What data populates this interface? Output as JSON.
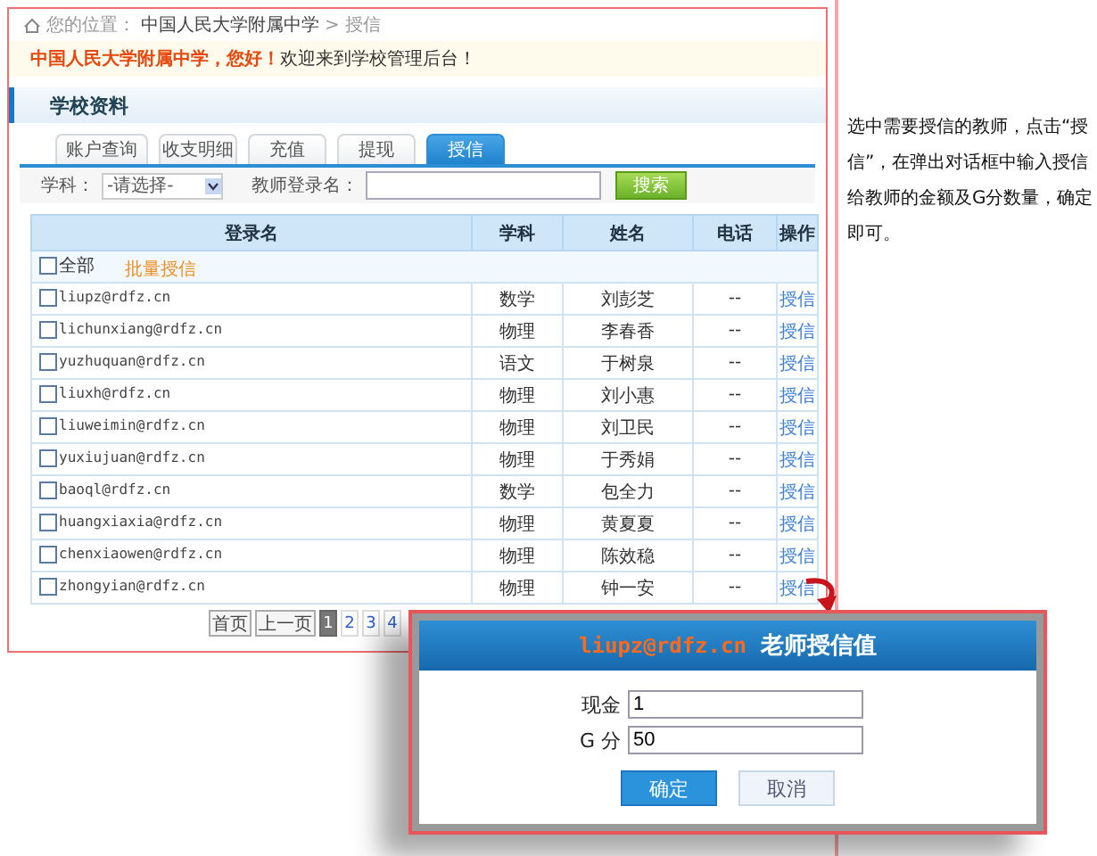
{
  "breadcrumb": {
    "label": "您的位置：",
    "school": "中国人民大学附属中学",
    "separator": ">",
    "current": "授信"
  },
  "welcome": {
    "school": "中国人民大学附属中学，您好！",
    "message": "欢迎来到学校管理后台！"
  },
  "section_title": "学校资料",
  "tabs": [
    {
      "label": "账户查询",
      "selected": false
    },
    {
      "label": "收支明细",
      "selected": false
    },
    {
      "label": "充值",
      "selected": false
    },
    {
      "label": "提现",
      "selected": false
    },
    {
      "label": "授信",
      "selected": true
    }
  ],
  "filter": {
    "subject_label": "学科：",
    "subject_value": "-请选择-",
    "teacher_label": "教师登录名：",
    "search_button": "搜索"
  },
  "table": {
    "columns": [
      "登录名",
      "学科",
      "姓名",
      "电话",
      "操作"
    ],
    "select_all": {
      "label": "全部",
      "checked": false
    },
    "batch_link": "批量授信",
    "rows": [
      {
        "login": "liupz@rdfz.cn",
        "subject": "数学",
        "name": "刘彭芝",
        "phone": "--",
        "action": "授信",
        "checked": false
      },
      {
        "login": "lichunxiang@rdfz.cn",
        "subject": "物理",
        "name": "李春香",
        "phone": "--",
        "action": "授信",
        "checked": false
      },
      {
        "login": "yuzhuquan@rdfz.cn",
        "subject": "语文",
        "name": "于树泉",
        "phone": "--",
        "action": "授信",
        "checked": false
      },
      {
        "login": "liuxh@rdfz.cn",
        "subject": "物理",
        "name": "刘小惠",
        "phone": "--",
        "action": "授信",
        "checked": false
      },
      {
        "login": "liuweimin@rdfz.cn",
        "subject": "物理",
        "name": "刘卫民",
        "phone": "--",
        "action": "授信",
        "checked": false
      },
      {
        "login": "yuxiujuan@rdfz.cn",
        "subject": "物理",
        "name": "于秀娟",
        "phone": "--",
        "action": "授信",
        "checked": false
      },
      {
        "login": "baoql@rdfz.cn",
        "subject": "数学",
        "name": "包全力",
        "phone": "--",
        "action": "授信",
        "checked": false
      },
      {
        "login": "huangxiaxia@rdfz.cn",
        "subject": "物理",
        "name": "黄夏夏",
        "phone": "--",
        "action": "授信",
        "checked": false
      },
      {
        "login": "chenxiaowen@rdfz.cn",
        "subject": "物理",
        "name": "陈效稳",
        "phone": "--",
        "action": "授信",
        "checked": false
      },
      {
        "login": "zhongyian@rdfz.cn",
        "subject": "物理",
        "name": "钟一安",
        "phone": "--",
        "action": "授信",
        "checked": false
      }
    ]
  },
  "pagination": {
    "first": "首页",
    "prev": "上一页",
    "pages": [
      {
        "label": "1",
        "selected": true
      },
      {
        "label": "2",
        "selected": false
      },
      {
        "label": "3",
        "selected": false
      },
      {
        "label": "4",
        "selected": false
      }
    ]
  },
  "note": "选中需要授信的教师，点击“授信”，在弹出对话框中输入授信给教师的金额及G分数量，确定即可。",
  "dialog": {
    "login": "liupz@rdfz.cn",
    "title": "老师授信值",
    "cash_label": "现金",
    "cash_value": "1",
    "points_label": "G 分",
    "points_value": "50",
    "ok": "确定",
    "cancel": "取消"
  }
}
